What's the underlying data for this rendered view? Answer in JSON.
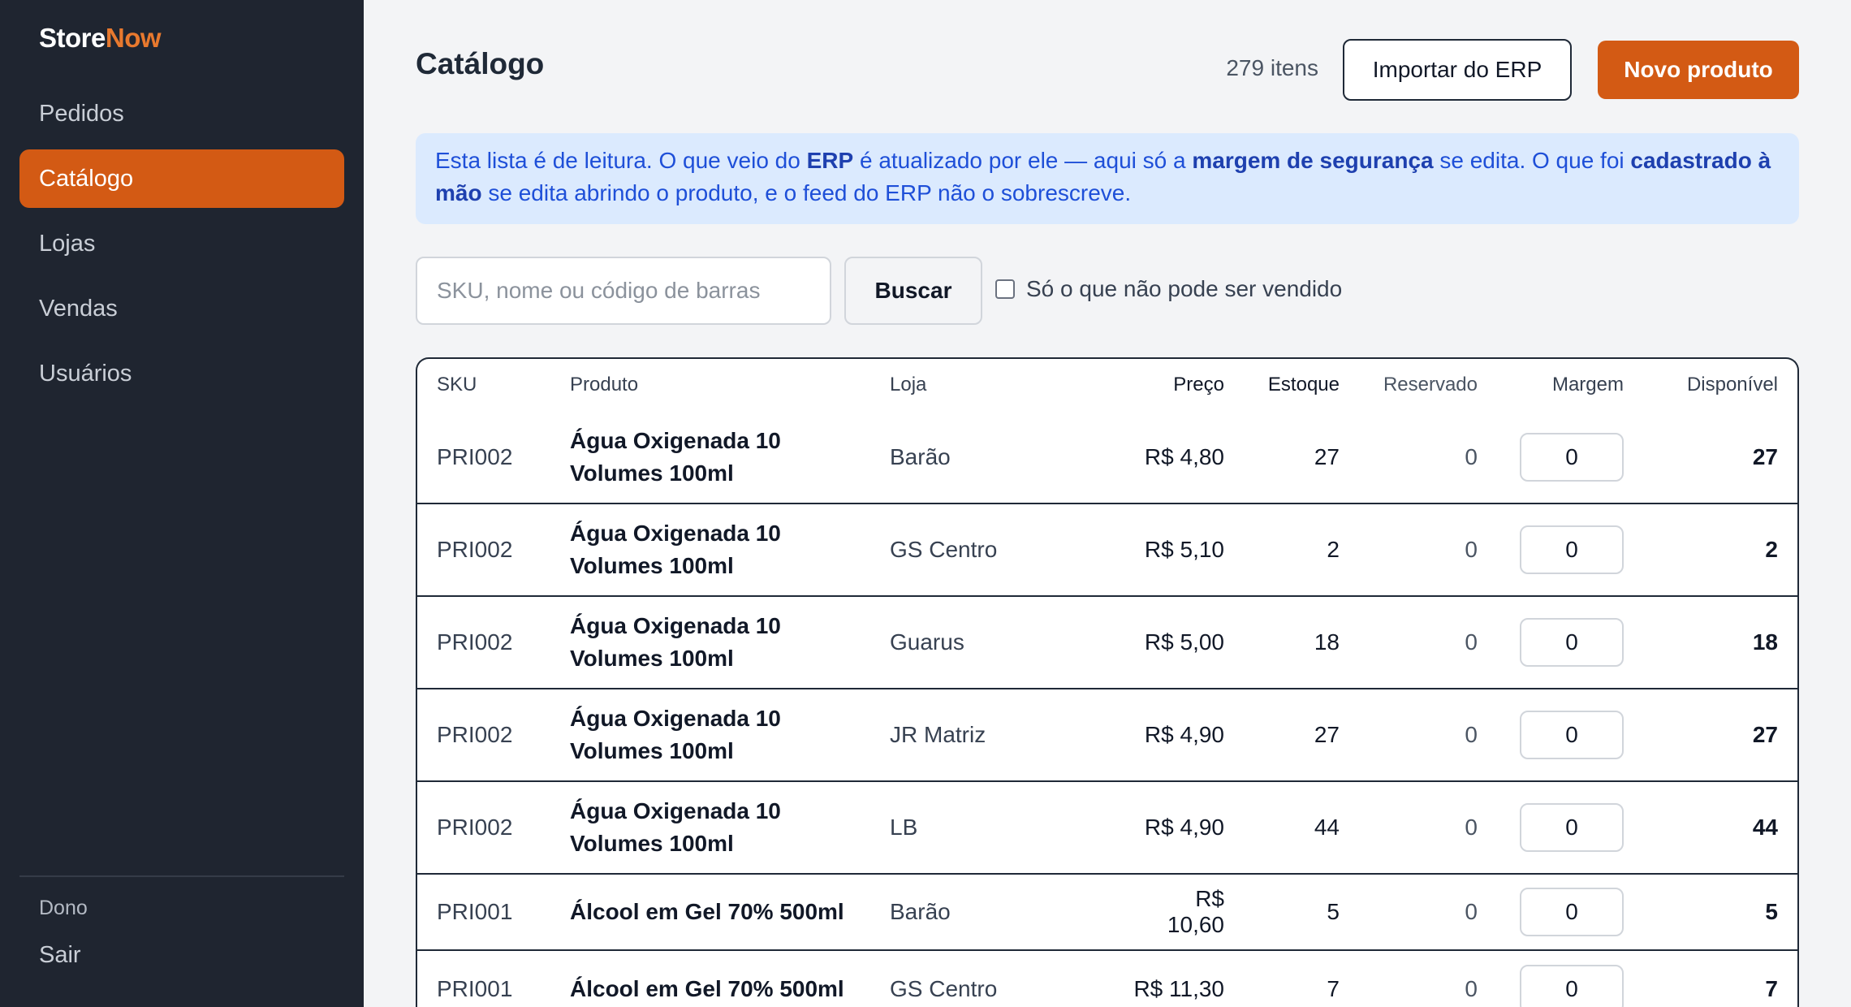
{
  "brand": {
    "part1": "Store",
    "part2": "Now"
  },
  "nav": [
    {
      "label": "Pedidos",
      "active": false
    },
    {
      "label": "Catálogo",
      "active": true
    },
    {
      "label": "Lojas",
      "active": false
    },
    {
      "label": "Vendas",
      "active": false
    },
    {
      "label": "Usuários",
      "active": false
    }
  ],
  "user": {
    "role": "Dono",
    "logout": "Sair"
  },
  "page": {
    "title": "Catálogo",
    "count": "279 itens",
    "import_label": "Importar do ERP",
    "new_label": "Novo produto"
  },
  "notice": {
    "t1": "Esta lista é de leitura. O que veio do ",
    "b1": "ERP",
    "t2": " é atualizado por ele — aqui só a ",
    "b2": "margem de segurança",
    "t3": " se edita. O que foi ",
    "b3": "cadastrado à mão",
    "t4": " se edita abrindo o produto, e o feed do ERP não o sobrescreve."
  },
  "search": {
    "placeholder": "SKU, nome ou código de barras",
    "value": "",
    "button": "Buscar",
    "filter_label": "Só o que não pode ser vendido",
    "filter_checked": false
  },
  "colors": {
    "accent": "#d35a14",
    "sidebar": "#1f2530",
    "notice_bg": "#dbeafe"
  },
  "table": {
    "headers": {
      "sku": "SKU",
      "product": "Produto",
      "store": "Loja",
      "price": "Preço",
      "stock": "Estoque",
      "reserved": "Reservado",
      "margin": "Margem",
      "available": "Disponível"
    },
    "rows": [
      {
        "sku": "PRI002",
        "product": "Água Oxigenada 10 Volumes 100ml",
        "store": "Barão",
        "price": "R$ 4,80",
        "stock": "27",
        "reserved": "0",
        "margin": "0",
        "available": "27"
      },
      {
        "sku": "PRI002",
        "product": "Água Oxigenada 10 Volumes 100ml",
        "store": "GS Centro",
        "price": "R$ 5,10",
        "stock": "2",
        "reserved": "0",
        "margin": "0",
        "available": "2"
      },
      {
        "sku": "PRI002",
        "product": "Água Oxigenada 10 Volumes 100ml",
        "store": "Guarus",
        "price": "R$ 5,00",
        "stock": "18",
        "reserved": "0",
        "margin": "0",
        "available": "18"
      },
      {
        "sku": "PRI002",
        "product": "Água Oxigenada 10 Volumes 100ml",
        "store": "JR Matriz",
        "price": "R$ 4,90",
        "stock": "27",
        "reserved": "0",
        "margin": "0",
        "available": "27"
      },
      {
        "sku": "PRI002",
        "product": "Água Oxigenada 10 Volumes 100ml",
        "store": "LB",
        "price": "R$ 4,90",
        "stock": "44",
        "reserved": "0",
        "margin": "0",
        "available": "44"
      },
      {
        "sku": "PRI001",
        "product": "Álcool em Gel 70% 500ml",
        "store": "Barão",
        "price": "R$ 10,60",
        "stock": "5",
        "reserved": "0",
        "margin": "0",
        "available": "5"
      },
      {
        "sku": "PRI001",
        "product": "Álcool em Gel 70% 500ml",
        "store": "GS Centro",
        "price": "R$ 11,30",
        "stock": "7",
        "reserved": "0",
        "margin": "0",
        "available": "7"
      }
    ]
  }
}
